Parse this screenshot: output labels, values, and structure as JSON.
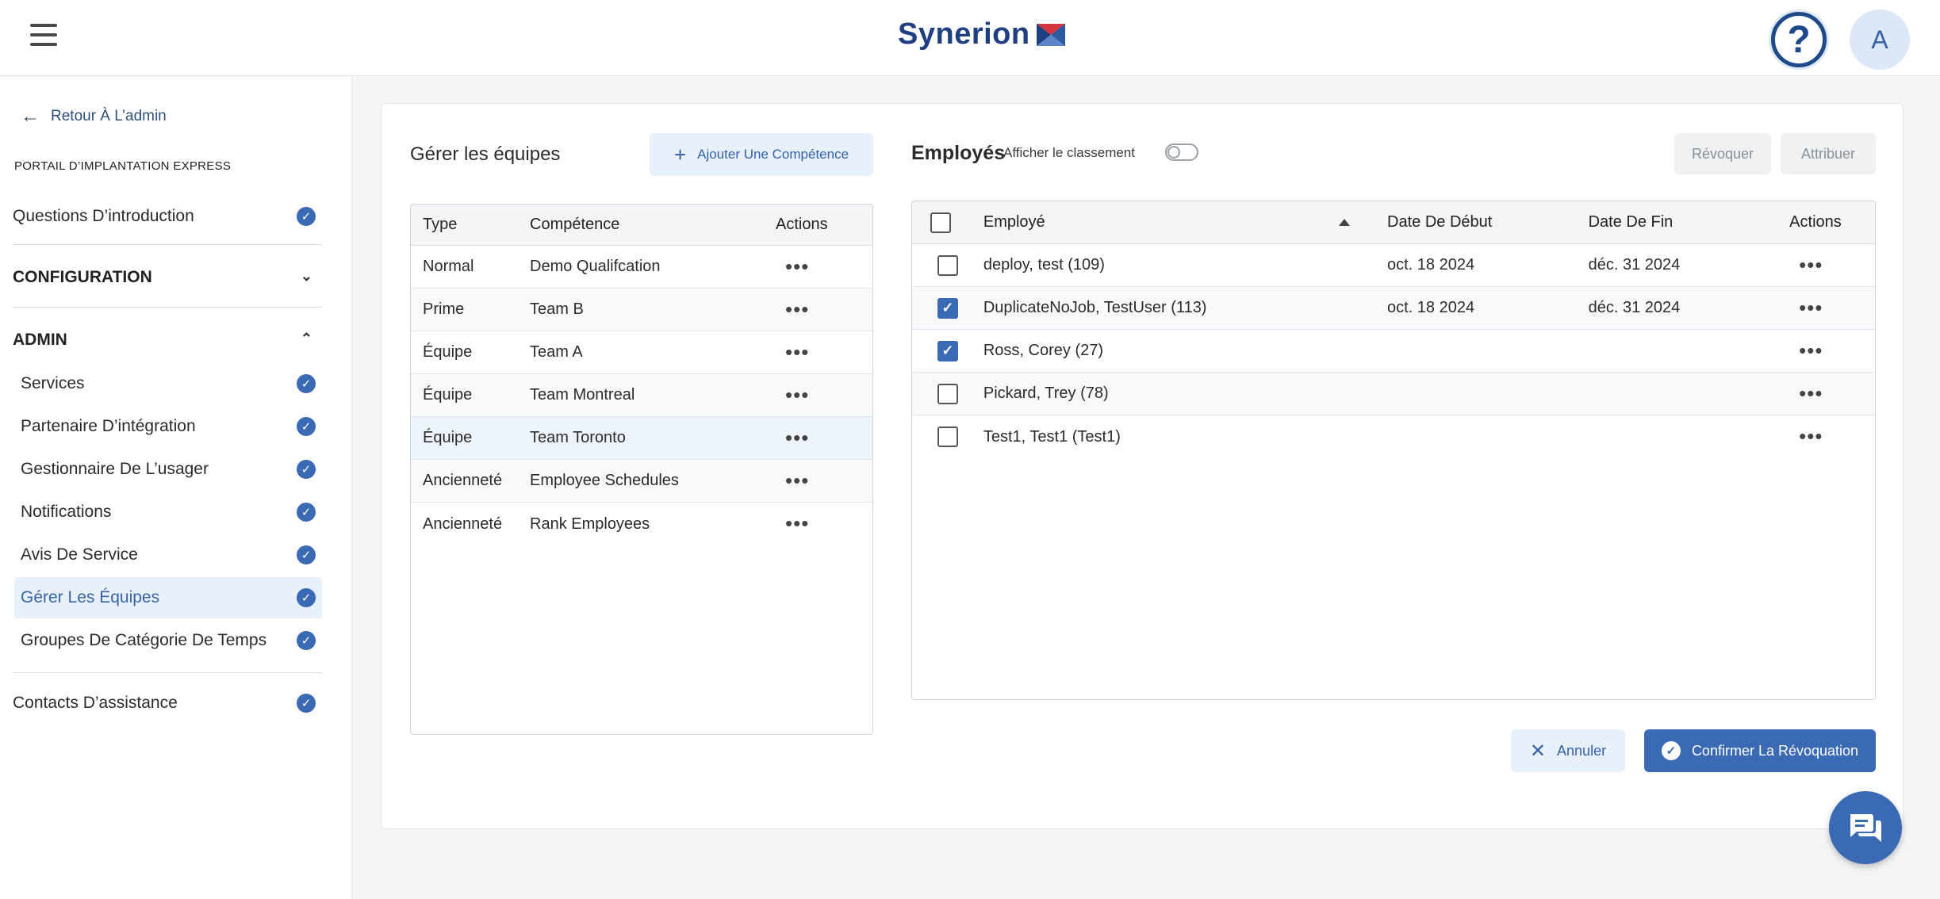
{
  "header": {
    "logo_text": "Synerion",
    "avatar_initial": "A",
    "help_symbol": "?"
  },
  "sidebar": {
    "back_label": "Retour À L’admin",
    "portal_label": "PORTAIL D’IMPLANTATION EXPRESS",
    "intro_item": "Questions D’introduction",
    "config_section": "CONFIGURATION",
    "admin_section": "ADMIN",
    "admin_items": [
      {
        "label": "Services"
      },
      {
        "label": "Partenaire D’intégration"
      },
      {
        "label": "Gestionnaire De L’usager"
      },
      {
        "label": "Notifications"
      },
      {
        "label": "Avis De Service"
      },
      {
        "label": "Gérer Les Équipes"
      },
      {
        "label": "Groupes De Catégorie De Temps"
      }
    ],
    "support_item": "Contacts D’assistance"
  },
  "teams": {
    "title": "Gérer les équipes",
    "add_button": "Ajouter Une Compétence",
    "columns": [
      "Type",
      "Compétence",
      "Actions"
    ],
    "rows": [
      {
        "type": "Normal",
        "skill": "Demo Qualifcation"
      },
      {
        "type": "Prime",
        "skill": "Team B"
      },
      {
        "type": "Équipe",
        "skill": "Team A"
      },
      {
        "type": "Équipe",
        "skill": "Team Montreal"
      },
      {
        "type": "Équipe",
        "skill": "Team Toronto"
      },
      {
        "type": "Ancienneté",
        "skill": "Employee Schedules"
      },
      {
        "type": "Ancienneté",
        "skill": "Rank Employees"
      }
    ]
  },
  "employees": {
    "title": "Employés",
    "rank_label": "Afficher le classement",
    "revoke_button": "Révoquer",
    "assign_button": "Attribuer",
    "columns": [
      "Employé",
      "Date De Début",
      "Date De Fin",
      "Actions"
    ],
    "rows": [
      {
        "name": "deploy, test (109)",
        "start": "oct. 18 2024",
        "end": "déc. 31 2024",
        "checked": false
      },
      {
        "name": "DuplicateNoJob, TestUser (113)",
        "start": "oct. 18 2024",
        "end": "déc. 31 2024",
        "checked": true
      },
      {
        "name": "Ross, Corey (27)",
        "start": "",
        "end": "",
        "checked": true
      },
      {
        "name": "Pickard, Trey (78)",
        "start": "",
        "end": "",
        "checked": false
      },
      {
        "name": "Test1, Test1 (Test1)",
        "start": "",
        "end": "",
        "checked": false
      }
    ]
  },
  "footer_actions": {
    "cancel": "Annuler",
    "confirm": "Confirmer La Révoquation"
  },
  "colors": {
    "accent": "#3a6ab4",
    "brand": "#1f3f82",
    "logo_red": "#d6353f"
  }
}
